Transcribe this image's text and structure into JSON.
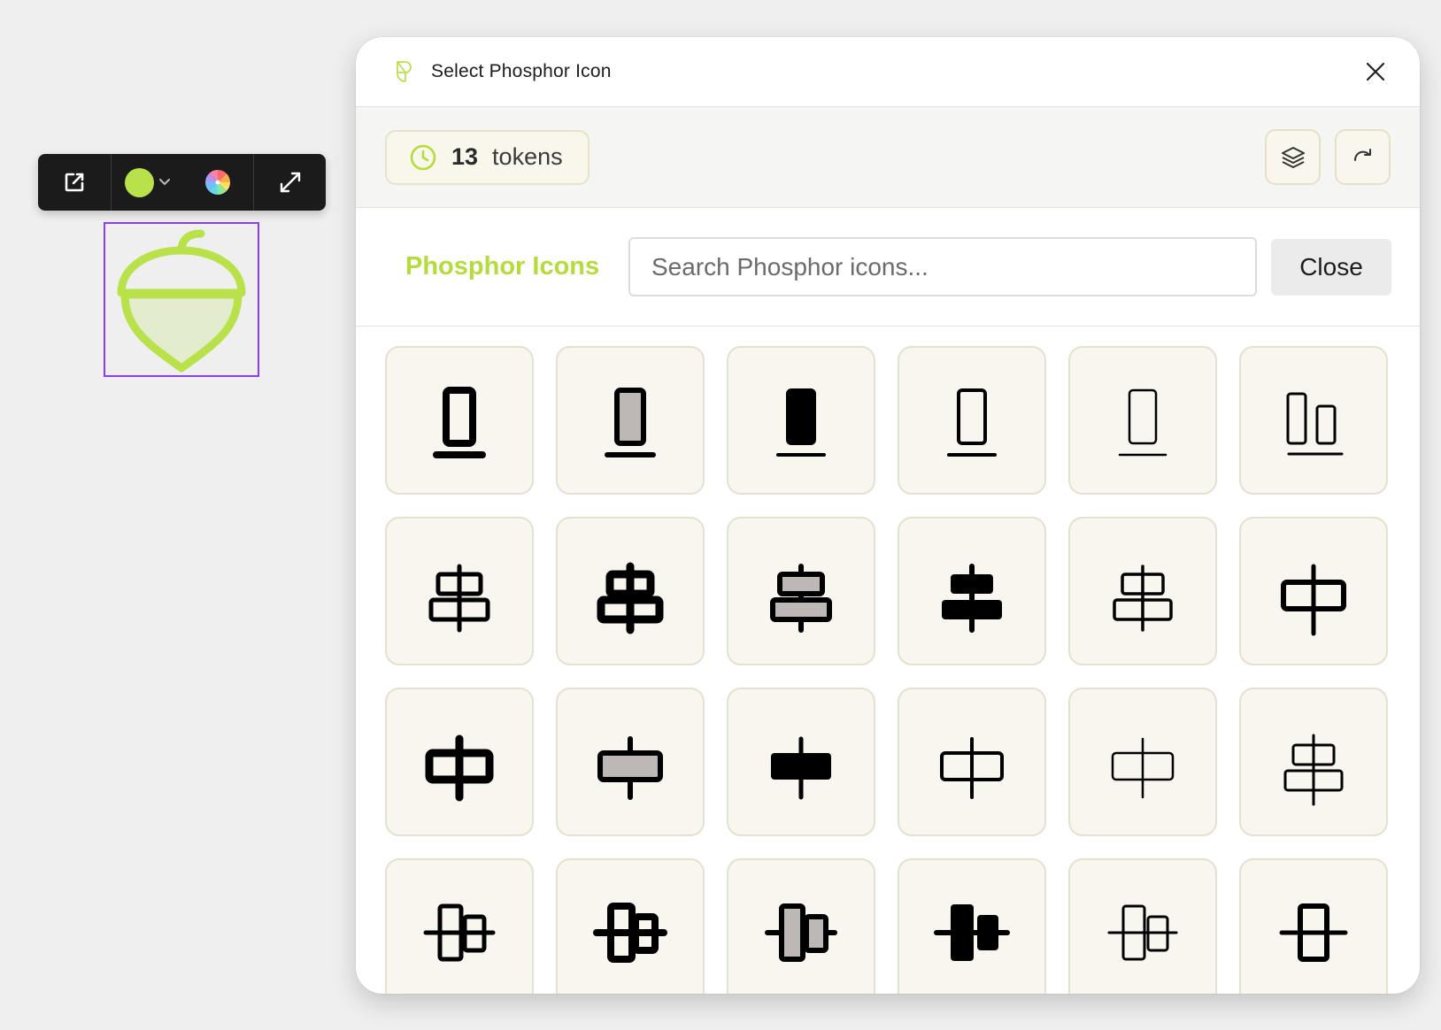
{
  "toolbar": {
    "items": [
      {
        "name": "open-external-icon"
      },
      {
        "name": "color-swatch",
        "color": "#b9e24a"
      },
      {
        "name": "color-wheel-icon"
      },
      {
        "name": "expand-icon"
      }
    ],
    "fill_color": "#b9e24a"
  },
  "canvas": {
    "selected_icon": "acorn-icon",
    "selection_color": "#8b3dff"
  },
  "dialog": {
    "title": "Select Phosphor Icon",
    "tokens": {
      "count": "13",
      "label": "tokens"
    },
    "brand": "Phosphor Icons",
    "search_placeholder": "Search Phosphor icons...",
    "close_label": "Close",
    "accent": "#b4dc3c"
  },
  "icons": [
    {
      "name": "align-bottom-bold-icon"
    },
    {
      "name": "align-bottom-duotone-icon"
    },
    {
      "name": "align-bottom-fill-icon"
    },
    {
      "name": "align-bottom-regular-icon"
    },
    {
      "name": "align-bottom-thin-icon"
    },
    {
      "name": "align-bottom-simple-icon"
    },
    {
      "name": "align-center-horizontal-regular-icon"
    },
    {
      "name": "align-center-horizontal-bold-icon"
    },
    {
      "name": "align-center-horizontal-duotone-icon"
    },
    {
      "name": "align-center-horizontal-fill-icon"
    },
    {
      "name": "align-center-horizontal-light-icon"
    },
    {
      "name": "align-center-horizontal-simple-icon"
    },
    {
      "name": "align-center-horizontal-simple-bold-icon"
    },
    {
      "name": "align-center-horizontal-simple-duotone-icon"
    },
    {
      "name": "align-center-horizontal-simple-fill-icon"
    },
    {
      "name": "align-center-horizontal-simple-light-icon"
    },
    {
      "name": "align-center-horizontal-simple-thin-icon"
    },
    {
      "name": "align-center-horizontal-thin-icon"
    },
    {
      "name": "align-center-vertical-regular-icon"
    },
    {
      "name": "align-center-vertical-bold-icon"
    },
    {
      "name": "align-center-vertical-duotone-icon"
    },
    {
      "name": "align-center-vertical-fill-icon"
    },
    {
      "name": "align-center-vertical-light-icon"
    },
    {
      "name": "align-center-vertical-simple-icon"
    }
  ]
}
